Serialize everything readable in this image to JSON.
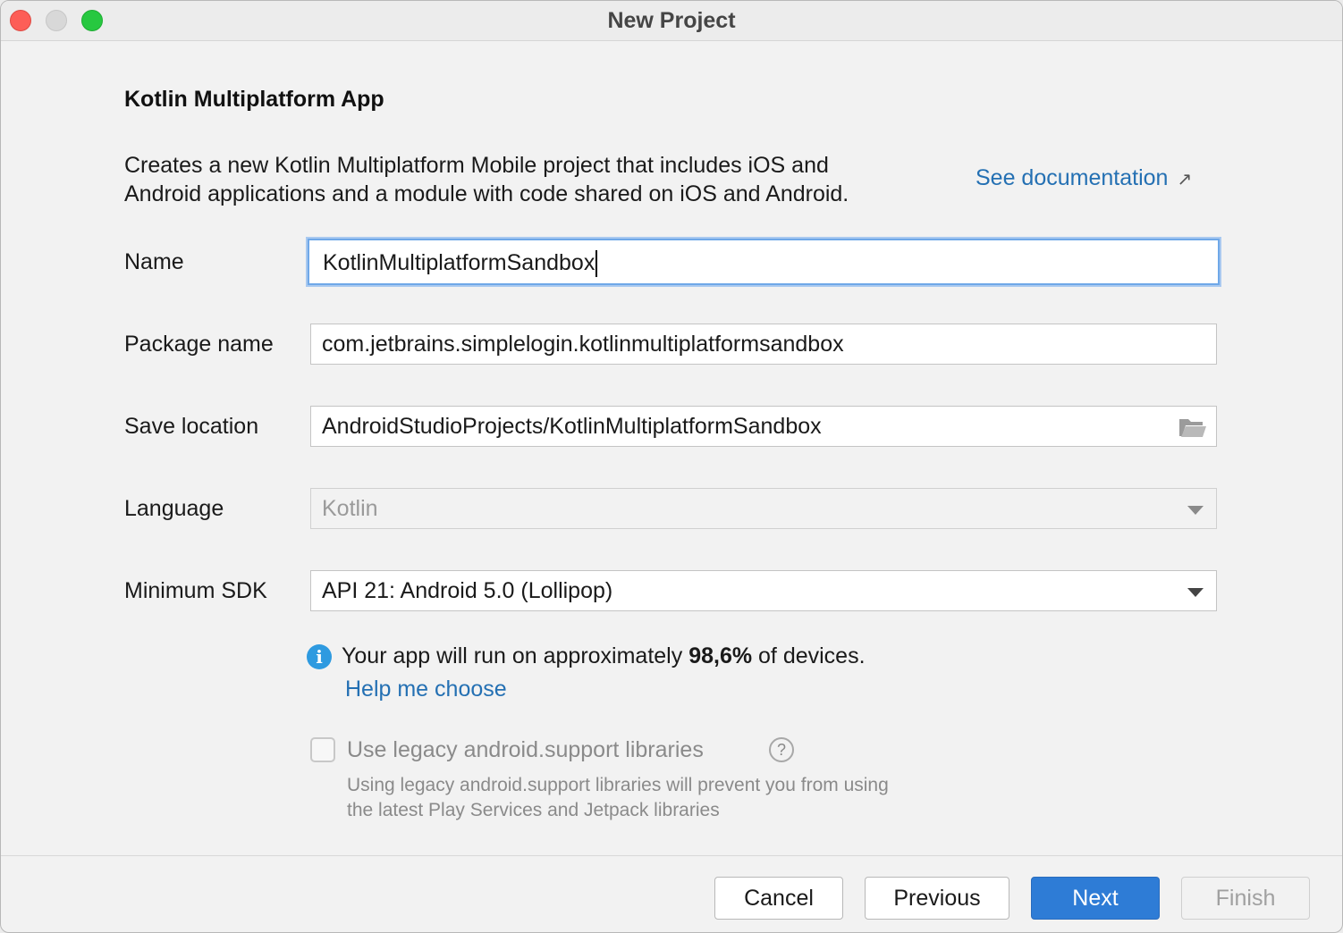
{
  "window": {
    "title": "New Project"
  },
  "template": {
    "heading": "Kotlin Multiplatform App",
    "description_line1": "Creates a new Kotlin Multiplatform Mobile project that includes iOS and",
    "description_line2": "Android applications and a module with code shared on iOS and Android.",
    "doc_link": "See documentation"
  },
  "form": {
    "name_label": "Name",
    "name_value": "KotlinMultiplatformSandbox",
    "package_label": "Package name",
    "package_value": "com.jetbrains.simplelogin.kotlinmultiplatformsandbox",
    "location_label": "Save location",
    "location_value": "AndroidStudioProjects/KotlinMultiplatformSandbox",
    "language_label": "Language",
    "language_value": "Kotlin",
    "sdk_label": "Minimum SDK",
    "sdk_value": "API 21: Android 5.0 (Lollipop)"
  },
  "info": {
    "icon": "i",
    "text_before": "Your app will run on approximately ",
    "percentage": "98,6%",
    "text_after": " of devices.",
    "help_link": "Help me choose"
  },
  "legacy": {
    "checkbox_label": "Use legacy android.support libraries",
    "help_icon": "?",
    "hint_line1": "Using legacy android.support libraries will prevent you from using",
    "hint_line2": "the latest Play Services and Jetpack libraries",
    "checked": false
  },
  "buttons": {
    "cancel": "Cancel",
    "previous": "Previous",
    "next": "Next",
    "finish": "Finish"
  },
  "colors": {
    "accent": "#2e7cd6",
    "link": "#2470b3",
    "info_icon": "#2e9ae0",
    "focus_ring": "#6fa8e8"
  }
}
